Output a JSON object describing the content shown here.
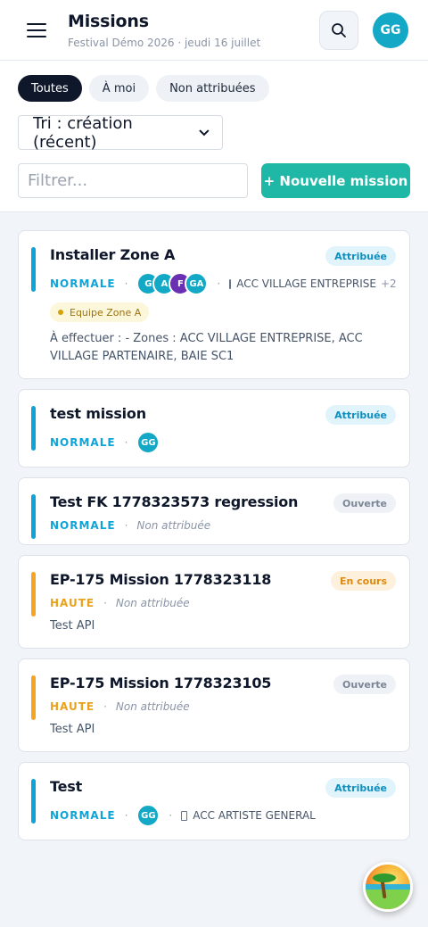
{
  "header": {
    "title": "Missions",
    "subtitle": "Festival Démo 2026 · jeudi 16 juillet",
    "avatar_initials": "GG"
  },
  "tabs": [
    {
      "label": "Toutes",
      "active": true
    },
    {
      "label": "À moi",
      "active": false
    },
    {
      "label": "Non attribuées",
      "active": false
    }
  ],
  "sort": {
    "label": "Tri : création (récent)"
  },
  "filter": {
    "placeholder": "Filtrer..."
  },
  "new_mission_label": "+ Nouvelle mission",
  "missions": [
    {
      "title": "Installer Zone A",
      "status": "Attribuée",
      "priority": "NORMALE",
      "avatars": [
        "G",
        "A",
        "F",
        "GA"
      ],
      "location": "ACC VILLAGE ENTREPRISE",
      "more": "+2",
      "team": "Equipe Zone A",
      "description": "À effectuer : - Zones : ACC VILLAGE ENTREPRISE, ACC VILLAGE PARTENAIRE, BAIE SC1"
    },
    {
      "title": "test mission",
      "status": "Attribuée",
      "priority": "NORMALE",
      "avatars": [
        "GG"
      ]
    },
    {
      "title": "Test FK 1778323573 regression",
      "status": "Ouverte",
      "priority": "NORMALE",
      "unassigned": "Non attribuée"
    },
    {
      "title": "EP-175 Mission 1778323118",
      "status": "En cours",
      "priority": "HAUTE",
      "unassigned": "Non attribuée",
      "description": "Test API"
    },
    {
      "title": "EP-175 Mission 1778323105",
      "status": "Ouverte",
      "priority": "HAUTE",
      "unassigned": "Non attribuée",
      "description": "Test API"
    },
    {
      "title": "Test",
      "status": "Attribuée",
      "priority": "NORMALE",
      "avatars": [
        "GG"
      ],
      "location": "ACC ARTISTE GENERAL"
    }
  ],
  "colors": {
    "accent": "#1fb8a6",
    "normal": "#0fa4d8",
    "high": "#f5a521",
    "dark": "#0f172a"
  }
}
